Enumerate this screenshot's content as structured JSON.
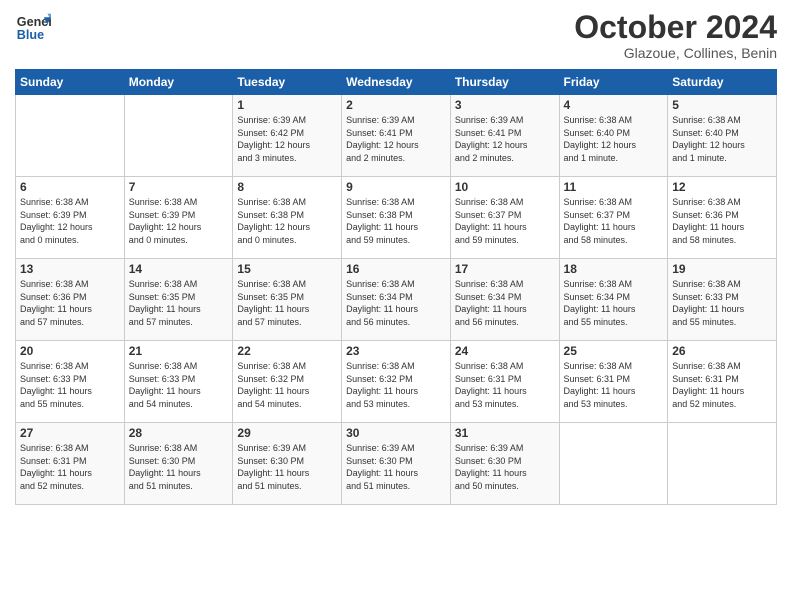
{
  "logo": {
    "line1": "General",
    "line2": "Blue"
  },
  "title": "October 2024",
  "location": "Glazoue, Collines, Benin",
  "days_header": [
    "Sunday",
    "Monday",
    "Tuesday",
    "Wednesday",
    "Thursday",
    "Friday",
    "Saturday"
  ],
  "weeks": [
    [
      {
        "day": "",
        "text": ""
      },
      {
        "day": "",
        "text": ""
      },
      {
        "day": "1",
        "text": "Sunrise: 6:39 AM\nSunset: 6:42 PM\nDaylight: 12 hours\nand 3 minutes."
      },
      {
        "day": "2",
        "text": "Sunrise: 6:39 AM\nSunset: 6:41 PM\nDaylight: 12 hours\nand 2 minutes."
      },
      {
        "day": "3",
        "text": "Sunrise: 6:39 AM\nSunset: 6:41 PM\nDaylight: 12 hours\nand 2 minutes."
      },
      {
        "day": "4",
        "text": "Sunrise: 6:38 AM\nSunset: 6:40 PM\nDaylight: 12 hours\nand 1 minute."
      },
      {
        "day": "5",
        "text": "Sunrise: 6:38 AM\nSunset: 6:40 PM\nDaylight: 12 hours\nand 1 minute."
      }
    ],
    [
      {
        "day": "6",
        "text": "Sunrise: 6:38 AM\nSunset: 6:39 PM\nDaylight: 12 hours\nand 0 minutes."
      },
      {
        "day": "7",
        "text": "Sunrise: 6:38 AM\nSunset: 6:39 PM\nDaylight: 12 hours\nand 0 minutes."
      },
      {
        "day": "8",
        "text": "Sunrise: 6:38 AM\nSunset: 6:38 PM\nDaylight: 12 hours\nand 0 minutes."
      },
      {
        "day": "9",
        "text": "Sunrise: 6:38 AM\nSunset: 6:38 PM\nDaylight: 11 hours\nand 59 minutes."
      },
      {
        "day": "10",
        "text": "Sunrise: 6:38 AM\nSunset: 6:37 PM\nDaylight: 11 hours\nand 59 minutes."
      },
      {
        "day": "11",
        "text": "Sunrise: 6:38 AM\nSunset: 6:37 PM\nDaylight: 11 hours\nand 58 minutes."
      },
      {
        "day": "12",
        "text": "Sunrise: 6:38 AM\nSunset: 6:36 PM\nDaylight: 11 hours\nand 58 minutes."
      }
    ],
    [
      {
        "day": "13",
        "text": "Sunrise: 6:38 AM\nSunset: 6:36 PM\nDaylight: 11 hours\nand 57 minutes."
      },
      {
        "day": "14",
        "text": "Sunrise: 6:38 AM\nSunset: 6:35 PM\nDaylight: 11 hours\nand 57 minutes."
      },
      {
        "day": "15",
        "text": "Sunrise: 6:38 AM\nSunset: 6:35 PM\nDaylight: 11 hours\nand 57 minutes."
      },
      {
        "day": "16",
        "text": "Sunrise: 6:38 AM\nSunset: 6:34 PM\nDaylight: 11 hours\nand 56 minutes."
      },
      {
        "day": "17",
        "text": "Sunrise: 6:38 AM\nSunset: 6:34 PM\nDaylight: 11 hours\nand 56 minutes."
      },
      {
        "day": "18",
        "text": "Sunrise: 6:38 AM\nSunset: 6:34 PM\nDaylight: 11 hours\nand 55 minutes."
      },
      {
        "day": "19",
        "text": "Sunrise: 6:38 AM\nSunset: 6:33 PM\nDaylight: 11 hours\nand 55 minutes."
      }
    ],
    [
      {
        "day": "20",
        "text": "Sunrise: 6:38 AM\nSunset: 6:33 PM\nDaylight: 11 hours\nand 55 minutes."
      },
      {
        "day": "21",
        "text": "Sunrise: 6:38 AM\nSunset: 6:33 PM\nDaylight: 11 hours\nand 54 minutes."
      },
      {
        "day": "22",
        "text": "Sunrise: 6:38 AM\nSunset: 6:32 PM\nDaylight: 11 hours\nand 54 minutes."
      },
      {
        "day": "23",
        "text": "Sunrise: 6:38 AM\nSunset: 6:32 PM\nDaylight: 11 hours\nand 53 minutes."
      },
      {
        "day": "24",
        "text": "Sunrise: 6:38 AM\nSunset: 6:31 PM\nDaylight: 11 hours\nand 53 minutes."
      },
      {
        "day": "25",
        "text": "Sunrise: 6:38 AM\nSunset: 6:31 PM\nDaylight: 11 hours\nand 53 minutes."
      },
      {
        "day": "26",
        "text": "Sunrise: 6:38 AM\nSunset: 6:31 PM\nDaylight: 11 hours\nand 52 minutes."
      }
    ],
    [
      {
        "day": "27",
        "text": "Sunrise: 6:38 AM\nSunset: 6:31 PM\nDaylight: 11 hours\nand 52 minutes."
      },
      {
        "day": "28",
        "text": "Sunrise: 6:38 AM\nSunset: 6:30 PM\nDaylight: 11 hours\nand 51 minutes."
      },
      {
        "day": "29",
        "text": "Sunrise: 6:39 AM\nSunset: 6:30 PM\nDaylight: 11 hours\nand 51 minutes."
      },
      {
        "day": "30",
        "text": "Sunrise: 6:39 AM\nSunset: 6:30 PM\nDaylight: 11 hours\nand 51 minutes."
      },
      {
        "day": "31",
        "text": "Sunrise: 6:39 AM\nSunset: 6:30 PM\nDaylight: 11 hours\nand 50 minutes."
      },
      {
        "day": "",
        "text": ""
      },
      {
        "day": "",
        "text": ""
      }
    ]
  ]
}
